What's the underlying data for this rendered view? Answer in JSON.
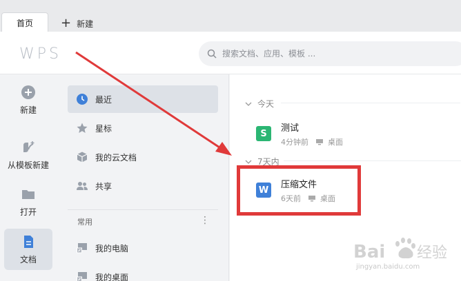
{
  "tabs": {
    "home": "首页",
    "new": "新建"
  },
  "header": {
    "logo": "WPS",
    "search_placeholder": "搜索文档、应用、模板 ..."
  },
  "rail": [
    {
      "label": "新建",
      "icon": "plus-circle-icon"
    },
    {
      "label": "从模板新建",
      "icon": "template-icon"
    },
    {
      "label": "打开",
      "icon": "folder-icon"
    },
    {
      "label": "文档",
      "icon": "document-icon",
      "active": true
    }
  ],
  "sidebar": {
    "items": [
      {
        "label": "最近",
        "icon": "clock-icon",
        "active": true
      },
      {
        "label": "星标",
        "icon": "star-icon"
      },
      {
        "label": "我的云文档",
        "icon": "cloud-doc-icon"
      },
      {
        "label": "共享",
        "icon": "people-icon"
      }
    ],
    "section": "常用",
    "common": [
      {
        "label": "我的电脑",
        "icon": "computer-icon"
      },
      {
        "label": "我的桌面",
        "icon": "desktop-icon"
      }
    ]
  },
  "groups": [
    {
      "title": "今天",
      "files": [
        {
          "name": "测试",
          "time": "4分钟前",
          "location": "桌面",
          "type": "S",
          "color": "#2bb673"
        }
      ]
    },
    {
      "title": "7天内",
      "files": [
        {
          "name": "压缩文件",
          "time": "6天前",
          "location": "桌面",
          "type": "W",
          "color": "#3f80d8"
        }
      ]
    }
  ],
  "colors": {
    "accent": "#3f80d8",
    "annotation": "#e03a3a"
  },
  "watermark": {
    "brand": "Baidu经验",
    "url": "jingyan.baidu.com"
  }
}
